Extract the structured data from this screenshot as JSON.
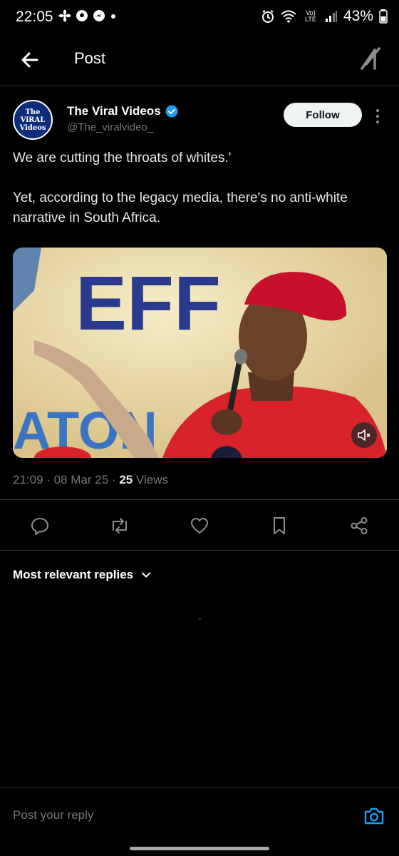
{
  "status_bar": {
    "time": "22:05",
    "battery": "43%",
    "network": "Vo) LTE"
  },
  "header": {
    "title": "Post"
  },
  "post": {
    "author_name": "The Viral Videos",
    "author_handle": "@The_viralvideo_",
    "avatar_text": [
      "The",
      "ViRAL",
      "Videos"
    ],
    "follow_label": "Follow",
    "text": "We are cutting the throats of whites.'\n\nYet, according to the legacy media, there's no anti-white narrative in South Africa.",
    "media_sign_text": "EFF",
    "media_sign_text2": "ATON",
    "time": "21:09 · 08 Mar 25 · ",
    "views_count": "25",
    "views_label": " Views"
  },
  "replies": {
    "sort_label": "Most relevant replies"
  },
  "reply_bar": {
    "placeholder": "Post your reply"
  },
  "colors": {
    "verified": "#1d9bf0",
    "camera": "#1d9bf0",
    "beret": "#c8102e",
    "shirt": "#d8232a"
  }
}
